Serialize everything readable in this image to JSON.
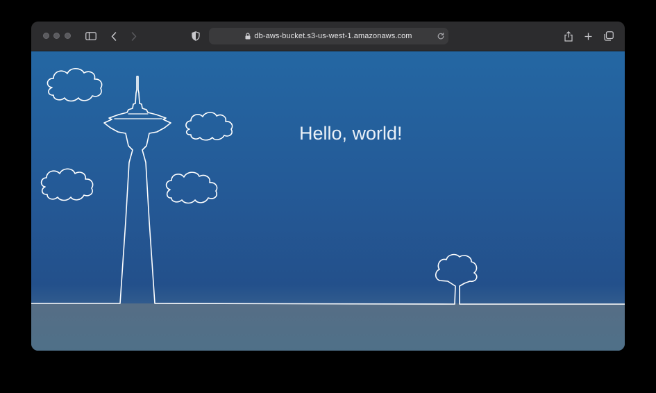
{
  "browser": {
    "url": "db-aws-bucket.s3-us-west-1.amazonaws.com",
    "icons": {
      "sidebar": "sidebar-icon",
      "back": "chevron-left-icon",
      "forward": "chevron-right-icon",
      "privacy": "shield-icon",
      "lock": "lock-icon",
      "reload": "reload-icon",
      "share": "share-icon",
      "new_tab": "plus-icon",
      "tabs": "tabs-overview-icon"
    }
  },
  "page": {
    "heading": "Hello, world!"
  },
  "colors": {
    "sky_top": "#2467a3",
    "sky_bottom": "#23508b",
    "ground": "#51728f",
    "line": "#ffffff",
    "toolbar": "#2c2c2e"
  }
}
